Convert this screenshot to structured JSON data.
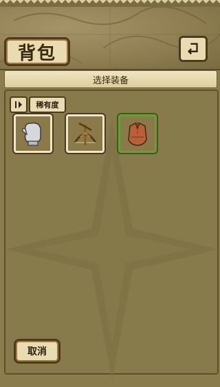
{
  "header": {
    "title": "背包"
  },
  "panel": {
    "title": "选择装备"
  },
  "sort": {
    "label": "稀有度"
  },
  "items": [
    {
      "icon": "glove-icon",
      "frame": "white"
    },
    {
      "icon": "bow-crossbow-icon",
      "frame": "white"
    },
    {
      "icon": "leather-armor-icon",
      "frame": "green"
    }
  ],
  "footer": {
    "cancel_label": "取消"
  },
  "colors": {
    "panel": "#8a7d4e",
    "rare_frame": "#6f9a3a",
    "common_frame": "#efe7c8"
  }
}
